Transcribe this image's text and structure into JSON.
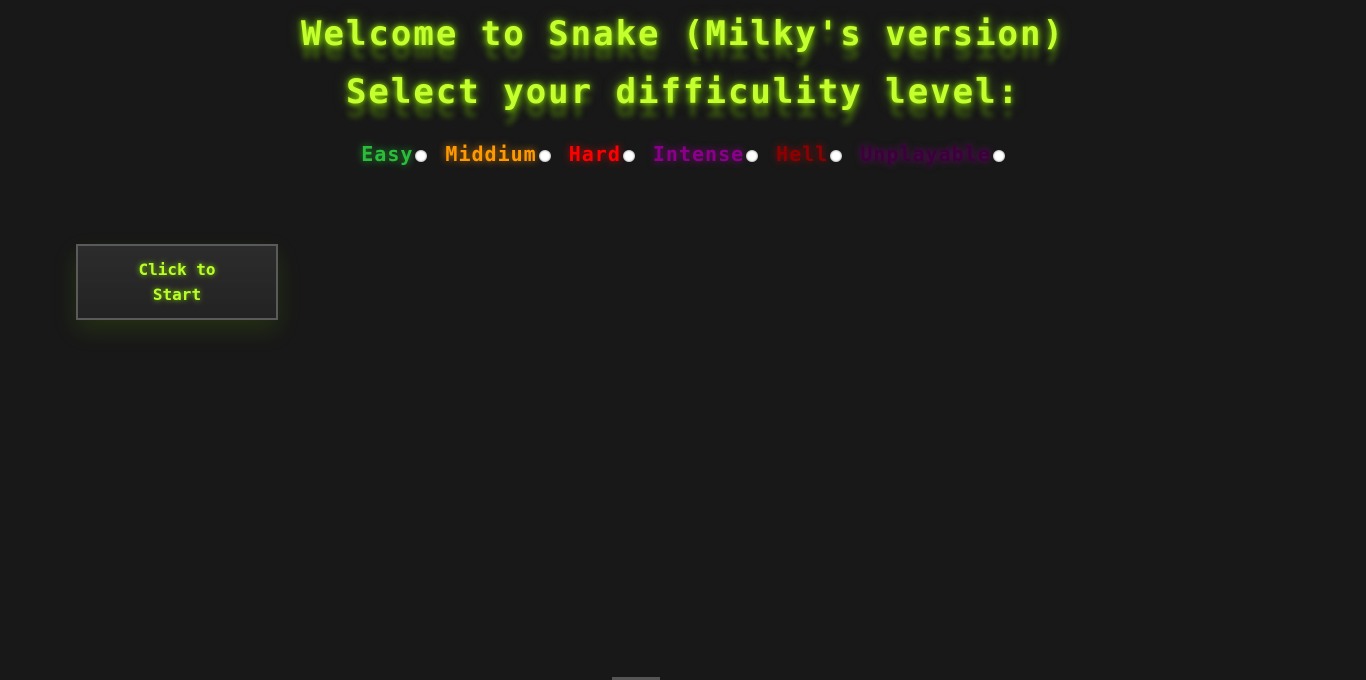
{
  "header": {
    "title": "Welcome to Snake (Milky's version)",
    "subtitle": "Select your difficulity level:",
    "accent_color": "#c6ff2e"
  },
  "difficulty": {
    "levels": [
      {
        "label": "Easy",
        "color": "#2bbd3a"
      },
      {
        "label": "Middium",
        "color": "#ff9900"
      },
      {
        "label": "Hard",
        "color": "#ff0000"
      },
      {
        "label": "Intense",
        "color": "#8a008a"
      },
      {
        "label": "Hell",
        "color": "#8b0000"
      },
      {
        "label": "Unplayable",
        "color": "#3b003b"
      }
    ]
  },
  "start": {
    "label": "Click to Start"
  }
}
